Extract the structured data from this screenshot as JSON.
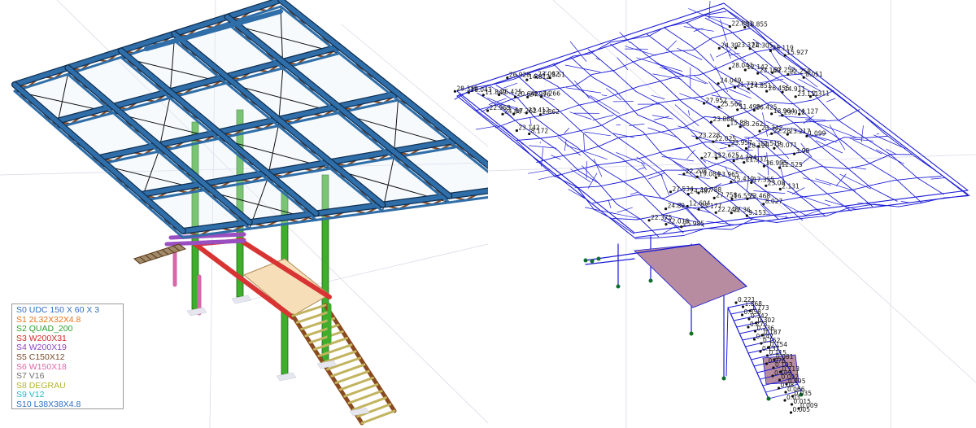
{
  "colors": {
    "beam_blue": "#2f6ea8",
    "beam_edge": "#0f2f52",
    "truss_brown": "#8a4a1f",
    "column_green": "#3fae2c",
    "beam_red": "#d83434",
    "beam_purple": "#9a4fc0",
    "beam_pink": "#d468a8",
    "slab_beige": "#f6dfb8",
    "stair_khaki": "#c2b35e",
    "mesh_blue": "#1b1bd6",
    "support_green": "#0f6e2c",
    "loaded_fill": "#b78ca0"
  },
  "legend": {
    "items": [
      {
        "label": "S0 UDC 150 X 60 X 3",
        "color": "#2f6fbf"
      },
      {
        "label": "S1 2L32X32X4.8",
        "color": "#e8741c"
      },
      {
        "label": "S2 QUAD_200",
        "color": "#2e9e2e"
      },
      {
        "label": "S3 W200X31",
        "color": "#d42a2a"
      },
      {
        "label": "S4 W200X19",
        "color": "#8e44c0"
      },
      {
        "label": "S5 C150X12",
        "color": "#7a4a2a"
      },
      {
        "label": "S6 W150X18",
        "color": "#e066aa"
      },
      {
        "label": "S7 V16",
        "color": "#707070"
      },
      {
        "label": "S8 DEGRAU",
        "color": "#b5b52a"
      },
      {
        "label": "S9 V12",
        "color": "#22b8c8"
      },
      {
        "label": "S10 L38X38X4.8",
        "color": "#2f6fbf"
      }
    ]
  },
  "results": {
    "labels": [
      "28.339",
      "27.952",
      "27.534",
      "24.39",
      "23.228",
      "22.375",
      "24.049",
      "22.208",
      "22.881",
      "23.888",
      "24.89",
      "28.043",
      "27.33",
      "26.043",
      "25.566",
      "24.487",
      "23.371",
      "22.025",
      "22.018",
      "21.772",
      "19.084",
      "18.855",
      "15.83",
      "12.604",
      "12.142",
      "12.625",
      "11.849",
      "11.499",
      "10.788",
      "24.305",
      "23.957",
      "25.985",
      "24.851",
      "23.965",
      "22.969",
      "23.262",
      "23.177",
      "23.169",
      "24.294",
      "25.425",
      "26.425",
      "27.758",
      "28.119",
      "28.128",
      "26.928",
      "26.455",
      "25.419",
      "24.88",
      "23.342",
      "22.248",
      "22.252",
      "21.937",
      "20.642",
      "18.964",
      "16.555",
      "15.927",
      "12.519",
      "14.812",
      "14.911",
      "17.355",
      "17.262",
      "22.28",
      "22.36",
      "22.258",
      "36.995",
      "24.976",
      "23.912",
      "23.468",
      "23.142",
      "23.071",
      "23.062",
      "23.111",
      "23.08",
      "23.412",
      "23.217",
      "9.153",
      "8.051",
      "12.525",
      "4.266",
      "4.127",
      "8.027",
      "8.172",
      "3.98",
      "3.51",
      "2.311",
      "2.131",
      "2.862",
      "1.099",
      "0.221",
      "1.868",
      "1.773",
      "0.358",
      "0.342",
      "0.302",
      "0.273",
      "0.236",
      "0.187",
      "0.147",
      "0.152",
      "0.154",
      "0.137",
      "0.115",
      "0.081",
      "0.076",
      "0.103",
      "0.113",
      "0.109",
      "0.092",
      "0.095",
      "0.08",
      "0.066",
      "0.035",
      "0.03",
      "0.015",
      "0.009",
      "0.005"
    ]
  }
}
